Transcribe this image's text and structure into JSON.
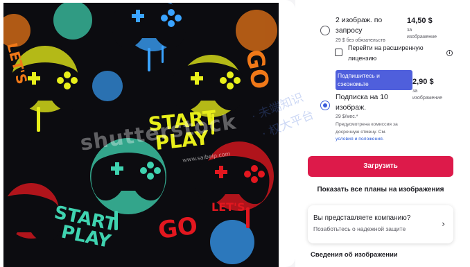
{
  "image": {
    "alt": "Seamless pattern of neon game controllers with START PLAY and LET'S GO lettering",
    "watermark": "shutterstock",
    "watermark_url": "www.saibeip.com",
    "palette": {
      "bg": "#0c0c10",
      "yellow": "#e8ef1a",
      "blue": "#3aa3ff",
      "teal": "#3fd3b0",
      "red": "#e3171f",
      "orange": "#f07818"
    }
  },
  "overlay_watermark": {
    "line1": "· 未端知识",
    "line2": "· 权大平台"
  },
  "options": {
    "single": {
      "title_line1": "2 изображ. по",
      "title_line2": "запросу",
      "subtitle": "29 $ без обязательств",
      "price": "14,50 $",
      "price_unit_line1": "за",
      "price_unit_line2": "изображение"
    },
    "extended": {
      "label_line1": "Перейти на расширенную",
      "label_line2": "лицензию",
      "info_icon": "info-icon"
    },
    "subscription": {
      "promo_line1": "Подпишитесь и",
      "promo_line2": "сэкономьте",
      "title_line1": "Подписка на 10",
      "title_line2": "изображ.",
      "subtitle": "29 $/мес.*",
      "price": "2,90 $",
      "price_unit_line1": "за",
      "price_unit_line2": "изображение",
      "note_line1": "Предусмотрена комиссия за",
      "note_line2": "досрочную отмену. См.",
      "note_link": "условия и положения."
    }
  },
  "actions": {
    "download": "Загрузить",
    "all_plans": "Показать все планы на изображения"
  },
  "company_card": {
    "question": "Вы представляете компанию?",
    "subtitle": "Позаботьтесь о надежной защите",
    "icon": "chevron-right-icon"
  },
  "details": {
    "title": "Сведения об изображении"
  },
  "colors": {
    "accent_red": "#dd1a4a",
    "accent_blue": "#3b5bdb",
    "promo_bg": "#4f5fdc",
    "link": "#2a5bd7"
  }
}
